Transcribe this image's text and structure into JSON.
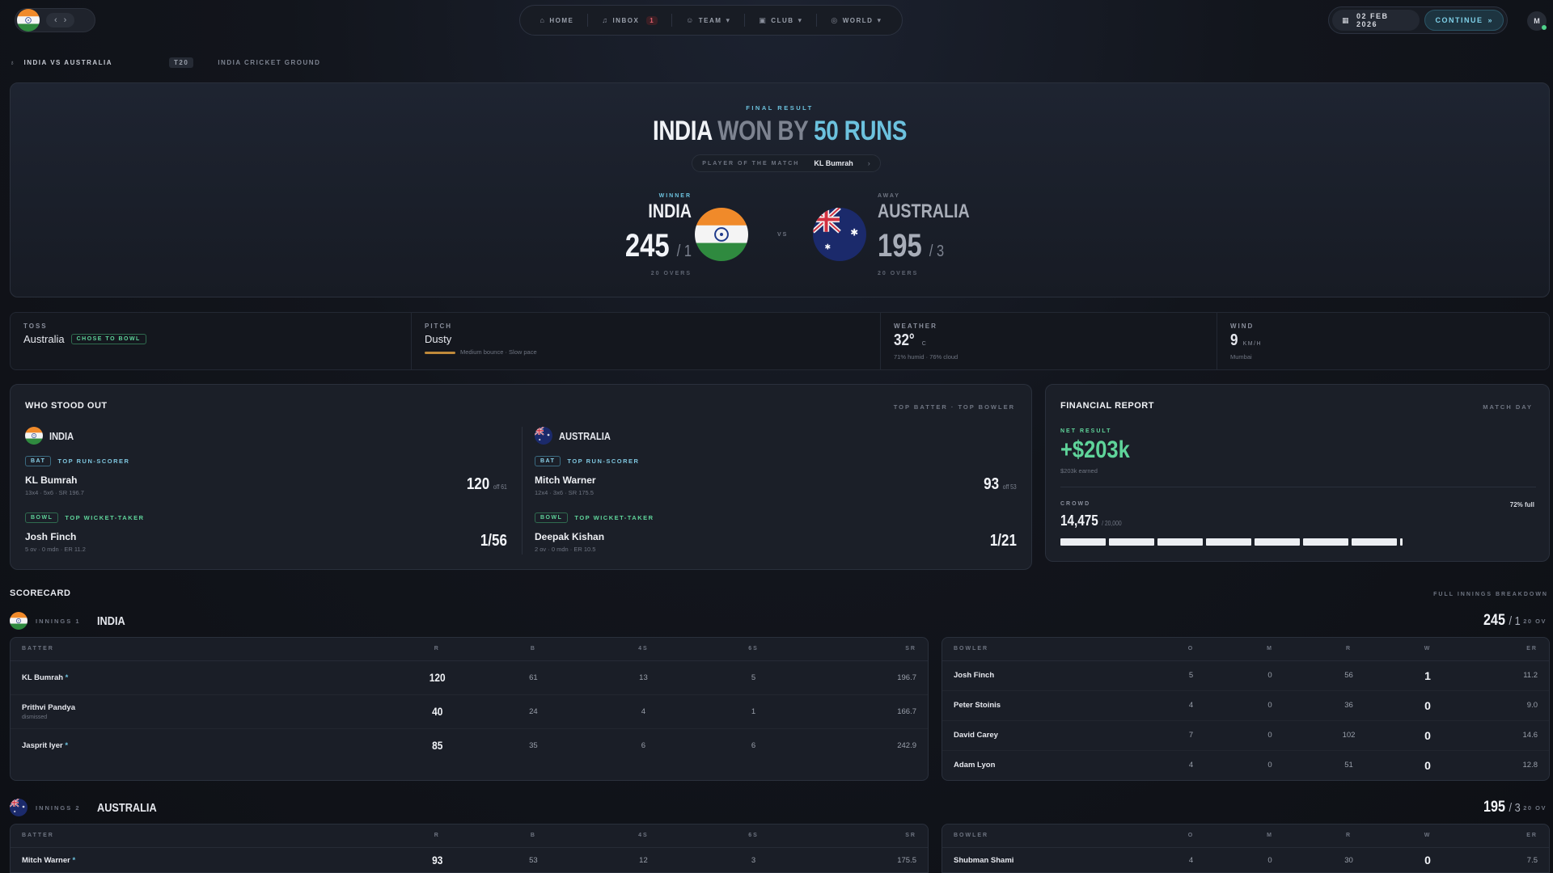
{
  "nav": {
    "home": "HOME",
    "inbox": "INBOX",
    "inbox_count": "1",
    "team": "TEAM",
    "club": "CLUB",
    "world": "WORLD"
  },
  "header": {
    "date": "02 FEB 2026",
    "continue": "CONTINUE",
    "avatar": "M"
  },
  "breadcrumb": {
    "match": "INDIA VS AUSTRALIA",
    "format": "T20",
    "ground": "INDIA CRICKET GROUND"
  },
  "result": {
    "label": "FINAL RESULT",
    "w1": "INDIA",
    "w2": "WON BY",
    "w3": "50 RUNS",
    "potm_label": "PLAYER OF THE MATCH",
    "potm_name": "KL Bumrah",
    "vs": "VS",
    "home": {
      "tag": "WINNER",
      "name": "INDIA",
      "runs": "245",
      "wkts": "/ 1",
      "overs": "20 OVERS"
    },
    "away": {
      "tag": "AWAY",
      "name": "AUSTRALIA",
      "runs": "195",
      "wkts": "/ 3",
      "overs": "20 OVERS"
    }
  },
  "conditions": {
    "toss_label": "TOSS",
    "toss_team": "Australia",
    "toss_choice": "CHOSE TO BOWL",
    "pitch_label": "PITCH",
    "pitch_value": "Dusty",
    "pitch_note": "Medium bounce · Slow pace",
    "weather_label": "WEATHER",
    "weather_temp": "32°",
    "weather_unit": "C",
    "weather_note": "71% humid · 76% cloud",
    "wind_label": "WIND",
    "wind_value": "9",
    "wind_unit": "KM/H",
    "wind_note": "Mumbai"
  },
  "standout": {
    "title": "WHO STOOD OUT",
    "sub": "TOP BATTER · TOP BOWLER",
    "india": {
      "team": "INDIA",
      "bat_role": "BAT",
      "bat_desc": "TOP RUN-SCORER",
      "bat_name": "KL Bumrah",
      "bat_stat": "13x4 · 5x6 · SR 196.7",
      "bat_fig": "120",
      "bat_off": "off 61",
      "bowl_role": "BOWL",
      "bowl_desc": "TOP WICKET-TAKER",
      "bowl_name": "Josh Finch",
      "bowl_stat": "5 ov · 0 mdn · ER 11.2",
      "bowl_fig": "1/56"
    },
    "australia": {
      "team": "AUSTRALIA",
      "bat_role": "BAT",
      "bat_desc": "TOP RUN-SCORER",
      "bat_name": "Mitch Warner",
      "bat_stat": "12x4 · 3x6 · SR 175.5",
      "bat_fig": "93",
      "bat_off": "off 53",
      "bowl_role": "BOWL",
      "bowl_desc": "TOP WICKET-TAKER",
      "bowl_name": "Deepak Kishan",
      "bowl_stat": "2 ov · 0 mdn · ER 10.5",
      "bowl_fig": "1/21"
    }
  },
  "finance": {
    "title": "FINANCIAL REPORT",
    "sub": "MATCH DAY",
    "net_label": "NET RESULT",
    "net_value": "+$203k",
    "net_note": "$203k earned",
    "crowd_label": "CROWD",
    "crowd_pct": "72% full",
    "crowd_fill": 0.72,
    "crowd_value": "14,475",
    "crowd_cap": "/ 20,000"
  },
  "scorecard": {
    "title": "SCORECARD",
    "sub": "FULL INNINGS BREAKDOWN",
    "bat_headers": [
      "BATTER",
      "R",
      "B",
      "4S",
      "6S",
      "SR"
    ],
    "bowl_headers": [
      "BOWLER",
      "O",
      "M",
      "R",
      "W",
      "ER"
    ],
    "innings1": {
      "label": "INNINGS 1",
      "team": "INDIA",
      "total": "245",
      "wkts": "/ 1",
      "overs": "20 OV",
      "batters": [
        {
          "name": "KL Bumrah",
          "star": "*",
          "sub": "",
          "r": "120",
          "b": "61",
          "f": "13",
          "s": "5",
          "sr": "196.7"
        },
        {
          "name": "Prithvi Pandya",
          "star": "",
          "sub": "dismissed",
          "r": "40",
          "b": "24",
          "f": "4",
          "s": "1",
          "sr": "166.7"
        },
        {
          "name": "Jasprit Iyer",
          "star": "*",
          "sub": "",
          "r": "85",
          "b": "35",
          "f": "6",
          "s": "6",
          "sr": "242.9"
        }
      ],
      "bowlers": [
        {
          "name": "Josh Finch",
          "o": "5",
          "m": "0",
          "r": "56",
          "w": "1",
          "er": "11.2"
        },
        {
          "name": "Peter Stoinis",
          "o": "4",
          "m": "0",
          "r": "36",
          "w": "0",
          "er": "9.0"
        },
        {
          "name": "David Carey",
          "o": "7",
          "m": "0",
          "r": "102",
          "w": "0",
          "er": "14.6"
        },
        {
          "name": "Adam Lyon",
          "o": "4",
          "m": "0",
          "r": "51",
          "w": "0",
          "er": "12.8"
        }
      ]
    },
    "innings2": {
      "label": "INNINGS 2",
      "team": "AUSTRALIA",
      "total": "195",
      "wkts": "/ 3",
      "overs": "20 OV",
      "batters": [
        {
          "name": "Mitch Warner",
          "star": "*",
          "sub": "",
          "r": "93",
          "b": "53",
          "f": "12",
          "s": "3",
          "sr": "175.5"
        }
      ],
      "bowlers": [
        {
          "name": "Shubman Shami",
          "o": "4",
          "m": "0",
          "r": "30",
          "w": "0",
          "er": "7.5"
        }
      ]
    }
  }
}
